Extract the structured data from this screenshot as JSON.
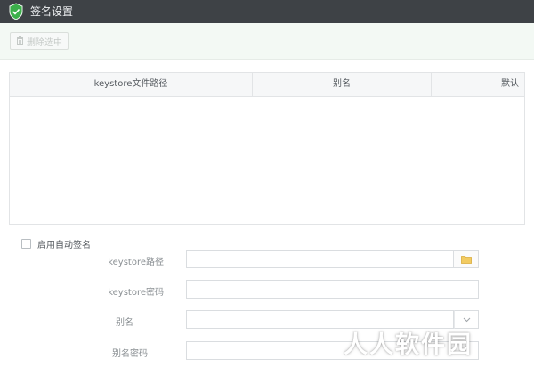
{
  "window": {
    "title": "签名设置",
    "logo_icon": "shield-check-icon"
  },
  "toolbar": {
    "delete_selected_label": "删除选中",
    "delete_icon": "trash-icon"
  },
  "table": {
    "columns": [
      "keystore文件路径",
      "别名",
      "默认"
    ],
    "rows": []
  },
  "auto_sign": {
    "label": "启用自动签名",
    "checked": false
  },
  "form": {
    "keystore_path_label": "keystore路径",
    "keystore_password_label": "keystore密码",
    "alias_label": "别名",
    "alias_password_label": "别名密码",
    "keystore_path_value": "",
    "keystore_password_value": "",
    "alias_value": "",
    "alias_password_value": ""
  },
  "watermark": "人人软件园",
  "colors": {
    "titlebar_bg": "#3e4246",
    "toolbar_bg": "#f3f9f4",
    "accent_green": "#3cb04a",
    "folder_yellow": "#f2cb61"
  }
}
